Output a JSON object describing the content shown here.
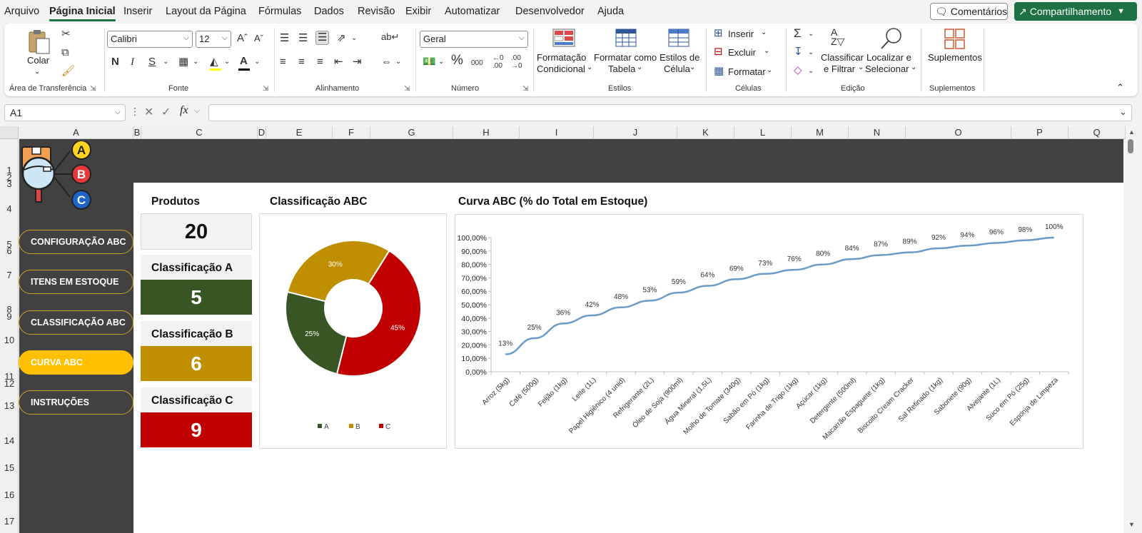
{
  "menu": {
    "tabs": [
      "Arquivo",
      "Página Inicial",
      "Inserir",
      "Layout da Página",
      "Fórmulas",
      "Dados",
      "Revisão",
      "Exibir",
      "Automatizar",
      "Desenvolvedor",
      "Ajuda"
    ],
    "active_index": 1,
    "comments_label": "Comentários",
    "share_label": "Compartilhamento"
  },
  "ribbon": {
    "clipboard": {
      "paste_label": "Colar",
      "group_label": "Área de Transferência"
    },
    "font": {
      "font_name": "Calibri",
      "font_size": "12",
      "bold": "N",
      "italic": "I",
      "underline": "S",
      "group_label": "Fonte"
    },
    "alignment": {
      "group_label": "Alinhamento"
    },
    "number": {
      "format": "Geral",
      "group_label": "Número"
    },
    "styles": {
      "conditional_label_1": "Formatação",
      "conditional_label_2": "Condicional",
      "table_label_1": "Formatar como",
      "table_label_2": "Tabela",
      "cell_styles_label_1": "Estilos de",
      "cell_styles_label_2": "Célula",
      "group_label": "Estilos"
    },
    "cells": {
      "insert_label": "Inserir",
      "delete_label": "Excluir",
      "format_label": "Formatar",
      "group_label": "Células"
    },
    "editing": {
      "sort_label_1": "Classificar",
      "sort_label_2": "e Filtrar",
      "find_label_1": "Localizar e",
      "find_label_2": "Selecionar",
      "group_label": "Edição"
    },
    "addins": {
      "label": "Suplementos",
      "group_label": "Suplementos"
    }
  },
  "formula_bar": {
    "name_box": "A1",
    "fx": "fx",
    "formula": ""
  },
  "columns": [
    "A",
    "B",
    "C",
    "D",
    "E",
    "F",
    "G",
    "H",
    "I",
    "J",
    "K",
    "L",
    "M",
    "N",
    "O",
    "P",
    "Q"
  ],
  "rows": [
    "1",
    "2",
    "3",
    "4",
    "5",
    "6",
    "7",
    "8",
    "9",
    "10",
    "11",
    "12",
    "13",
    "14",
    "15",
    "16",
    "17"
  ],
  "logo": {
    "letter_a": "A",
    "letter_b": "B",
    "letter_c": "C"
  },
  "nav": {
    "items": [
      "CONFIGURAÇÃO ABC",
      "ITENS EM ESTOQUE",
      "CLASSIFICAÇÃO ABC",
      "CURVA ABC",
      "INSTRUÇÕES"
    ],
    "active_index": 3
  },
  "kpis": {
    "products_title": "Produtos",
    "products_value": "20",
    "a_title": "Classificação A",
    "a_value": "5",
    "b_title": "Classificação B",
    "b_value": "6",
    "c_title": "Classificação C",
    "c_value": "9"
  },
  "colors": {
    "class_a": "#375623",
    "class_b": "#bf8f00",
    "class_c": "#c00000",
    "line": "#6b9cc8",
    "accent_green": "#1e7145",
    "nav_active": "#ffc000"
  },
  "chart_data": [
    {
      "type": "pie",
      "title": "Classificação ABC",
      "categories": [
        "A",
        "B",
        "C"
      ],
      "values": [
        25,
        30,
        45
      ],
      "labels": [
        "25%",
        "30%",
        "45%"
      ],
      "legend": "bottom"
    },
    {
      "type": "line",
      "title": "Curva ABC (% do Total em Estoque)",
      "categories": [
        "Arroz (5kg)",
        "Café (500g)",
        "Feijão (1kg)",
        "Leite (1L)",
        "Papel Higiênico (4 unid)",
        "Refrigerante (2L)",
        "Óleo de Soja (900ml)",
        "Água Mineral (1,5L)",
        "Molho de Tomate (340g)",
        "Sabão em Pó (1kg)",
        "Farinha de Trigo (1kg)",
        "Açúcar (1kg)",
        "Detergente (500ml)",
        "Macarrão Espaguete (1kg)",
        "Biscoito Cream Cracker",
        "Sal Refinado (1kg)",
        "Sabonete (90g)",
        "Alvejante (1L)",
        "Suco em Pó (25g)",
        "Esponja de Limpeza"
      ],
      "values": [
        13,
        25,
        36,
        42,
        48,
        53,
        59,
        64,
        69,
        73,
        76,
        80,
        84,
        87,
        89,
        92,
        94,
        96,
        98,
        100
      ],
      "labels": [
        "13%",
        "25%",
        "36%",
        "42%",
        "48%",
        "53%",
        "59%",
        "64%",
        "69%",
        "73%",
        "76%",
        "80%",
        "84%",
        "87%",
        "89%",
        "92%",
        "94%",
        "96%",
        "98%",
        "100%"
      ],
      "y_ticks": [
        "0,00%",
        "10,00%",
        "20,00%",
        "30,00%",
        "40,00%",
        "50,00%",
        "60,00%",
        "70,00%",
        "80,00%",
        "90,00%",
        "100,00%"
      ],
      "ylim": [
        0,
        100
      ],
      "grid": false
    }
  ]
}
